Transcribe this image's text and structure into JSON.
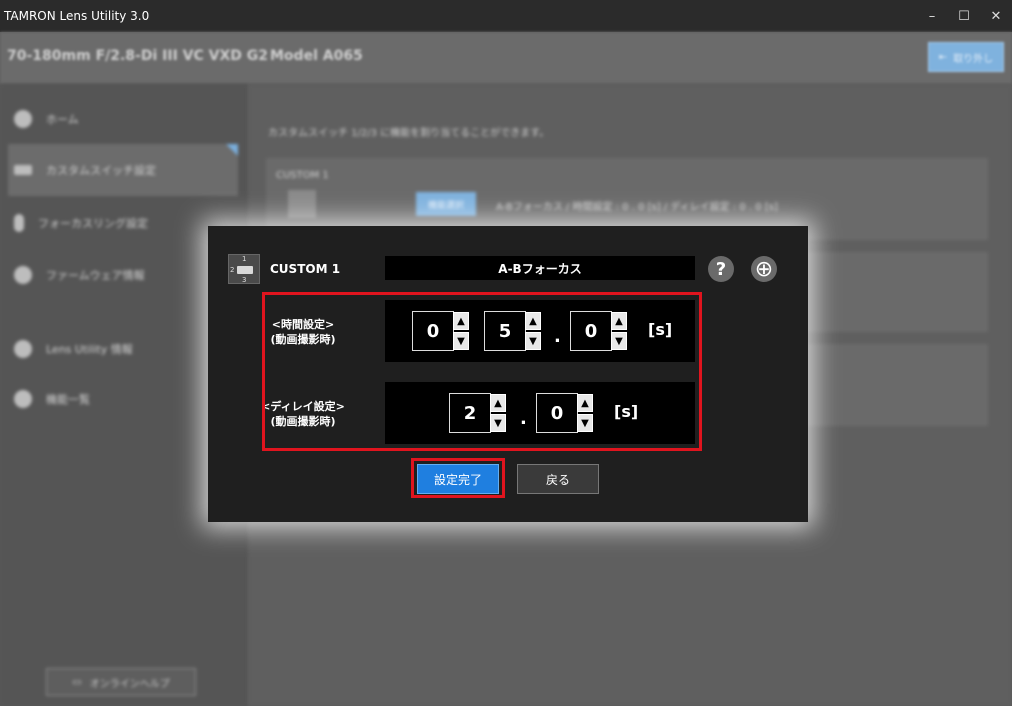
{
  "app": {
    "title": "TAMRON Lens Utility  3.0"
  },
  "window_controls": {
    "minimize": "–",
    "maximize": "☐",
    "close": "✕"
  },
  "header": {
    "lens_name": "70-180mm F/2.8-Di III VC VXD G2",
    "model": "Model A065",
    "remove_label": "取り外し"
  },
  "sidebar": {
    "items": [
      {
        "label": "ホーム",
        "icon": "home-icon"
      },
      {
        "label": "カスタムスイッチ設定",
        "icon": "switch-icon",
        "active": true
      },
      {
        "label": "フォーカスリング設定",
        "icon": "focus-ring-icon"
      },
      {
        "label": "ファームウェア情報",
        "icon": "firmware-icon"
      },
      {
        "label": "Lens Utility 情報",
        "icon": "info-icon"
      },
      {
        "label": "機能一覧",
        "icon": "list-icon"
      }
    ],
    "online_help_label": "オンラインヘルプ"
  },
  "main": {
    "description": "カスタムスイッチ 1/2/3 に機能を割り当てることができます。",
    "panels": [
      {
        "title": "CUSTOM 1",
        "func_button": "機能選択",
        "func_desc": "A-Bフォーカス / 時間設定 : 0 . 0 [s] / ディレイ設定 : 0 . 0 [s]"
      }
    ]
  },
  "dialog": {
    "icon_numbers": [
      "1",
      "2",
      "3"
    ],
    "title": "CUSTOM 1",
    "function_name": "A-Bフォーカス",
    "help_icon": "?",
    "globe_icon": "⊕",
    "time_setting": {
      "label_line1": "<時間設定>",
      "label_line2": "(動画撮影時)",
      "digits": [
        "0",
        "5",
        "0"
      ],
      "dot": ".",
      "unit": "[s]"
    },
    "delay_setting": {
      "label_line1": "<ディレイ設定>",
      "label_line2": "(動画撮影時)",
      "digits": [
        "2",
        "0"
      ],
      "dot": ".",
      "unit": "[s]"
    },
    "up_arrow": "▲",
    "down_arrow": "▼",
    "ok_label": "設定完了",
    "back_label": "戻る"
  },
  "colors": {
    "accent": "#1f7fe0",
    "highlight_frame": "#e0141e"
  }
}
